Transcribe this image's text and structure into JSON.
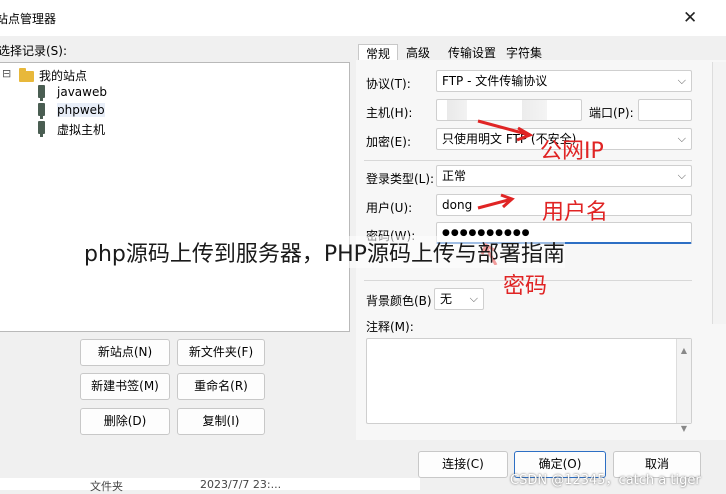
{
  "window": {
    "title": "站点管理器",
    "close_symbol": "✕"
  },
  "site_list": {
    "label": "选择记录(S):",
    "root": {
      "label": "我的站点",
      "expander": "⊟"
    },
    "items": [
      {
        "label": "javaweb"
      },
      {
        "label": "phpweb"
      },
      {
        "label": "虚拟主机"
      }
    ]
  },
  "left_buttons": {
    "new_site": "新站点(N)",
    "new_folder": "新文件夹(F)",
    "new_bookmark": "新建书签(M)",
    "rename": "重命名(R)",
    "delete": "删除(D)",
    "copy": "复制(I)"
  },
  "tabs": [
    "常规",
    "高级",
    "传输设置",
    "字符集"
  ],
  "general": {
    "protocol_label": "协议(T):",
    "protocol_value": "FTP - 文件传输协议",
    "host_label": "主机(H):",
    "host_value": "",
    "port_label": "端口(P):",
    "port_value": "",
    "encryption_label": "加密(E):",
    "encryption_value": "只使用明文 FTP (不安全)",
    "logon_type_label": "登录类型(L):",
    "logon_type_value": "正常",
    "user_label": "用户(U):",
    "user_value": "dong",
    "password_label": "密码(W):",
    "password_value": "●●●●●●●●●●",
    "bg_color_label": "背景颜色(B)",
    "bg_color_value": "无",
    "comments_label": "注释(M):"
  },
  "bottom_buttons": {
    "connect": "连接(C)",
    "ok": "确定(O)",
    "cancel": "取消"
  },
  "background_row": {
    "col1": "文件夹",
    "col2": "2023/7/7 23:..."
  },
  "annotations": {
    "public_ip": "公网IP",
    "username": "用户名",
    "password": "密码",
    "color": "#e02424"
  },
  "overlay_title": "php源码上传到服务器，PHP源码上传与部署指南",
  "csdn_watermark": "CSDN @12345，catch a tiger"
}
